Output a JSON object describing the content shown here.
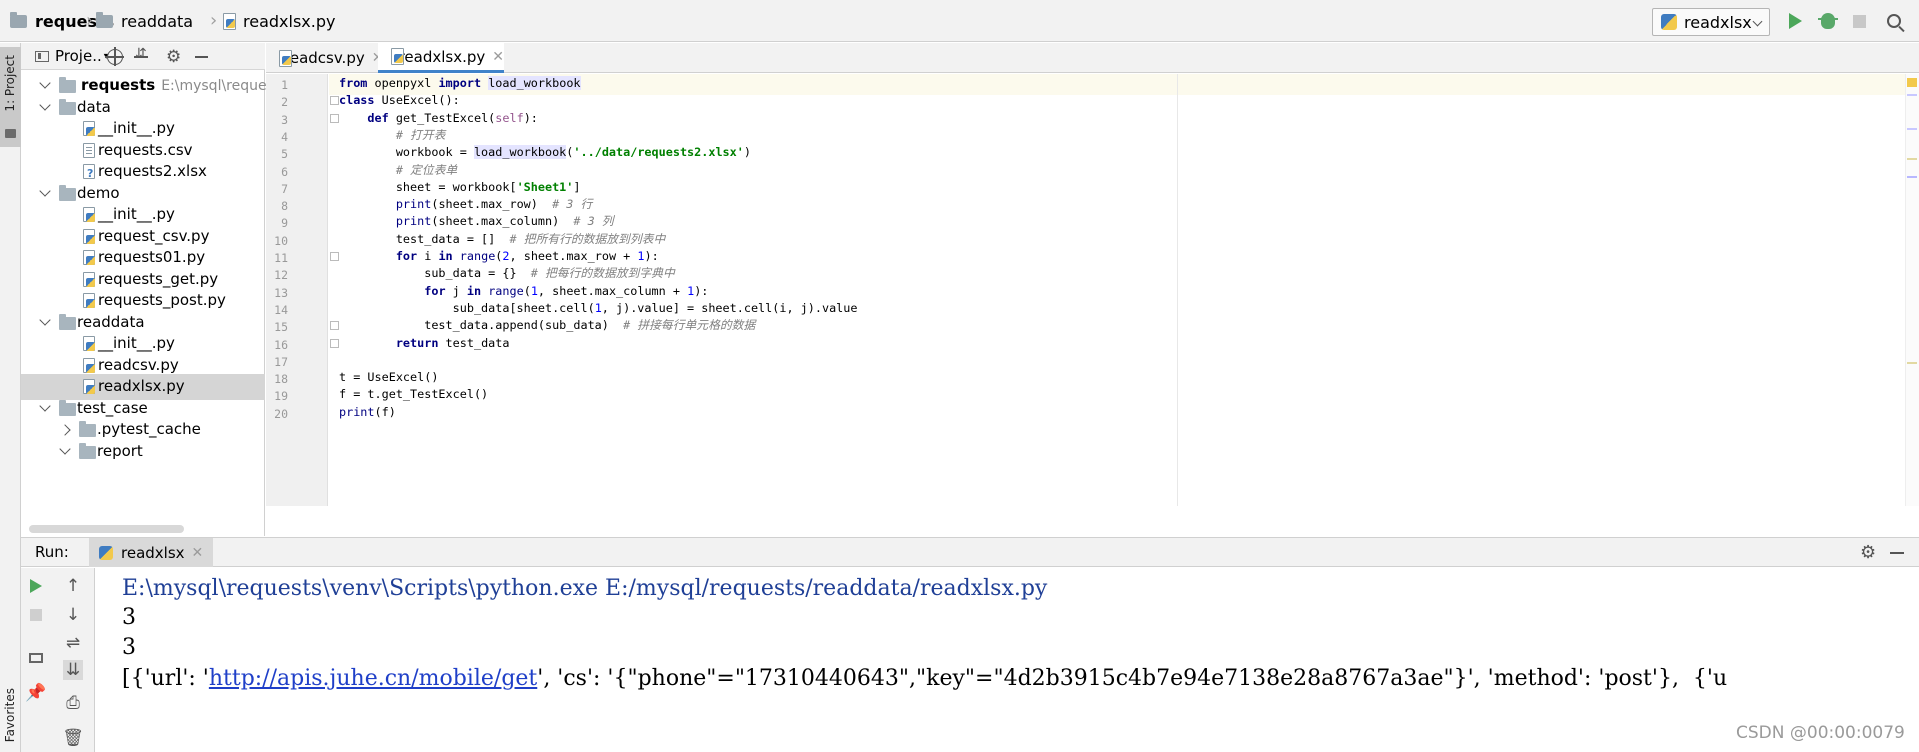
{
  "breadcrumbs": [
    "requests",
    "readdata",
    "readxlsx.py"
  ],
  "run_config": {
    "name": "readxlsx"
  },
  "left_stripe": {
    "project": "1: Project",
    "favorites": "Favorites"
  },
  "project_panel": {
    "title": "Proje..",
    "root": {
      "name": "requests",
      "path": "E:\\mysql\\requests"
    },
    "items": [
      {
        "label": "data",
        "type": "folder",
        "level": 1,
        "expanded": true
      },
      {
        "label": "__init__.py",
        "type": "py",
        "level": 2
      },
      {
        "label": "requests.csv",
        "type": "csv",
        "level": 2
      },
      {
        "label": "requests2.xlsx",
        "type": "xlsx",
        "level": 2
      },
      {
        "label": "demo",
        "type": "folder",
        "level": 1,
        "expanded": true
      },
      {
        "label": "__init__.py",
        "type": "py",
        "level": 2
      },
      {
        "label": "request_csv.py",
        "type": "py",
        "level": 2
      },
      {
        "label": "requests01.py",
        "type": "py",
        "level": 2
      },
      {
        "label": "requests_get.py",
        "type": "py",
        "level": 2
      },
      {
        "label": "requests_post.py",
        "type": "py",
        "level": 2
      },
      {
        "label": "readdata",
        "type": "folder",
        "level": 1,
        "expanded": true
      },
      {
        "label": "__init__.py",
        "type": "py",
        "level": 2
      },
      {
        "label": "readcsv.py",
        "type": "py",
        "level": 2
      },
      {
        "label": "readxlsx.py",
        "type": "py",
        "level": 2,
        "selected": true
      },
      {
        "label": "test_case",
        "type": "folder",
        "level": 1,
        "expanded": true
      },
      {
        "label": ".pytest_cache",
        "type": "folder",
        "level": 2,
        "expanded": false
      },
      {
        "label": "report",
        "type": "folder",
        "level": 2,
        "expanded": true
      }
    ]
  },
  "editor_tabs": [
    {
      "label": "readcsv.py",
      "active": false
    },
    {
      "label": "readxlsx.py",
      "active": true
    }
  ],
  "editor": {
    "line_numbers": [
      "1",
      "2",
      "3",
      "4",
      "5",
      "6",
      "7",
      "8",
      "9",
      "10",
      "11",
      "12",
      "13",
      "14",
      "15",
      "16",
      "17",
      "18",
      "19",
      "20"
    ],
    "lines": [
      "from openpyxl import load_workbook",
      "class UseExcel():",
      "    def get_TestExcel(self):",
      "        # 打开表",
      "        workbook = load_workbook('../data/requests2.xlsx')",
      "        # 定位表单",
      "        sheet = workbook['Sheet1']",
      "        print(sheet.max_row)  # 3 行",
      "        print(sheet.max_column)  # 3 列",
      "        test_data = []  # 把所有行的数据放到列表中",
      "        for i in range(2, sheet.max_row + 1):",
      "            sub_data = {}  # 把每行的数据放到字典中",
      "            for j in range(1, sheet.max_column + 1):",
      "                sub_data[sheet.cell(1, j).value] = sheet.cell(i, j).value",
      "            test_data.append(sub_data)  # 拼接每行单元格的数据",
      "        return test_data",
      "",
      "t = UseExcel()",
      "f = t.get_TestExcel()",
      "print(f)"
    ]
  },
  "run_panel": {
    "label": "Run:",
    "tab": "readxlsx",
    "output": [
      "E:\\mysql\\requests\\venv\\Scripts\\python.exe E:/mysql/requests/readdata/readxlsx.py",
      "3",
      "3"
    ],
    "last_line": {
      "prefix": "[{'url': '",
      "link": "http://apis.juhe.cn/mobile/get",
      "suffix": "', 'cs': '{\"phone\"=\"17310440643\",\"key\"=\"4d2b3915c4b7e94e7138e28a8767a3ae\"}', 'method': 'post'},  {'u"
    }
  },
  "watermark": "CSDN @00:00:0079",
  "colors": {
    "accent": "#4083c9",
    "keyword": "#000080",
    "string": "#008000",
    "comment": "#808080",
    "run_green": "#4ca75a"
  }
}
